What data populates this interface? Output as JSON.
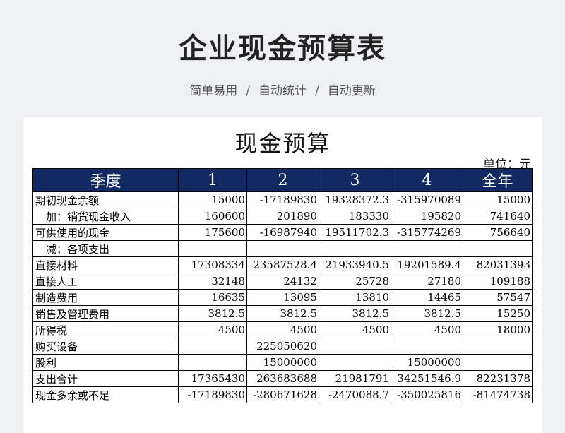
{
  "page": {
    "title": "企业现金预算表",
    "subtitle": [
      "简单易用",
      "自动统计",
      "自动更新"
    ],
    "separator": "/"
  },
  "sheet": {
    "title": "现金预算",
    "unit": "单位：元",
    "columns": [
      "季度",
      "1",
      "2",
      "3",
      "4",
      "全年"
    ],
    "rows": [
      {
        "label": "期初现金余额",
        "indent": false,
        "values": [
          "15000",
          "-17189830",
          "19328372.3",
          "-315970089",
          "15000"
        ]
      },
      {
        "label": "加：销货现金收入",
        "indent": true,
        "values": [
          "160600",
          "201890",
          "183330",
          "195820",
          "741640"
        ]
      },
      {
        "label": "可供使用的现金",
        "indent": false,
        "values": [
          "175600",
          "-16987940",
          "19511702.3",
          "-315774269",
          "756640"
        ]
      },
      {
        "label": "减：各项支出",
        "indent": true,
        "values": [
          "",
          "",
          "",
          "",
          ""
        ]
      },
      {
        "label": "直接材料",
        "indent": false,
        "values": [
          "17308334",
          "23587528.4",
          "21933940.5",
          "19201589.4",
          "82031393"
        ]
      },
      {
        "label": "直接人工",
        "indent": false,
        "values": [
          "32148",
          "24132",
          "25728",
          "27180",
          "109188"
        ]
      },
      {
        "label": "制造费用",
        "indent": false,
        "values": [
          "16635",
          "13095",
          "13810",
          "14465",
          "57547"
        ]
      },
      {
        "label": "销售及管理费用",
        "indent": false,
        "values": [
          "3812.5",
          "3812.5",
          "3812.5",
          "3812.5",
          "15250"
        ]
      },
      {
        "label": "所得税",
        "indent": false,
        "values": [
          "4500",
          "4500",
          "4500",
          "4500",
          "18000"
        ]
      },
      {
        "label": "购买设备",
        "indent": false,
        "values": [
          "",
          "225050620",
          "",
          "",
          ""
        ]
      },
      {
        "label": "股利",
        "indent": false,
        "values": [
          "",
          "15000000",
          "",
          "15000000",
          ""
        ]
      },
      {
        "label": "支出合计",
        "indent": false,
        "values": [
          "17365430",
          "263683688",
          "21981791",
          "34251546.9",
          "82231378"
        ]
      },
      {
        "label": "现金多余或不足",
        "indent": false,
        "values": [
          "-17189830",
          "-280671628",
          "-2470088.7",
          "-350025816",
          "-81474738"
        ]
      }
    ]
  },
  "colors": {
    "header_bg": "#122a61",
    "header_text": "#ffffff",
    "page_bg": "#eef0f4"
  }
}
